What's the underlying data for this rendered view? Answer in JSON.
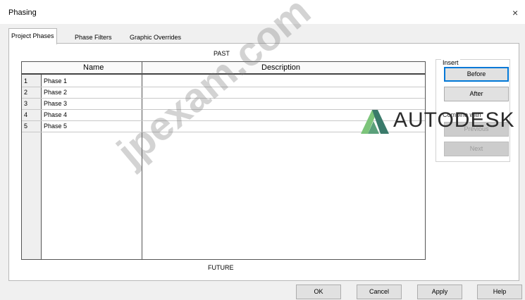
{
  "window": {
    "title": "Phasing",
    "close_glyph": "×"
  },
  "tabs": [
    {
      "label": "Project Phases",
      "active": true
    },
    {
      "label": "Phase Filters",
      "active": false
    },
    {
      "label": "Graphic Overrides",
      "active": false
    }
  ],
  "phases": {
    "past_label": "PAST",
    "future_label": "FUTURE",
    "columns": {
      "name": "Name",
      "description": "Description"
    },
    "rows": [
      {
        "num": "1",
        "name": "Phase 1",
        "description": ""
      },
      {
        "num": "2",
        "name": "Phase 2",
        "description": ""
      },
      {
        "num": "3",
        "name": "Phase 3",
        "description": ""
      },
      {
        "num": "4",
        "name": "Phase 4",
        "description": ""
      },
      {
        "num": "5",
        "name": "Phase 5",
        "description": ""
      }
    ]
  },
  "insert_group": {
    "label": "Insert",
    "before_label": "Before",
    "after_label": "After",
    "combine_label": "Combine with",
    "previous_label": "Previous",
    "next_label": "Next"
  },
  "footer": {
    "ok_label": "OK",
    "cancel_label": "Cancel",
    "apply_label": "Apply",
    "help_label": "Help"
  },
  "branding": {
    "logo_text": "AUTODESK",
    "logo_icon": "autodesk-triangle-icon",
    "watermark": "jpexam.com",
    "colors": {
      "logo_dark": "#3a7a6a",
      "logo_light": "#7cc47a"
    }
  },
  "colors": {
    "accent": "#0078d7"
  }
}
